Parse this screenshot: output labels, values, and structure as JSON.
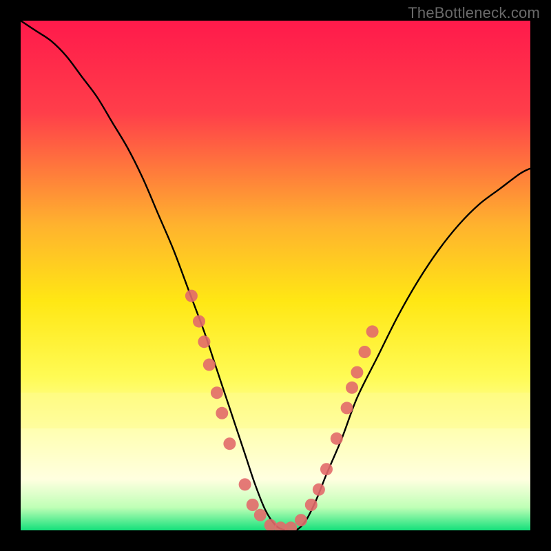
{
  "watermark": "TheBottleneck.com",
  "chart_data": {
    "type": "line",
    "title": "",
    "xlabel": "",
    "ylabel": "",
    "xlim": [
      0,
      100
    ],
    "ylim": [
      0,
      100
    ],
    "background_gradient": {
      "stops": [
        {
          "offset": 0.0,
          "color": "#ff1a4b"
        },
        {
          "offset": 0.18,
          "color": "#ff3e4a"
        },
        {
          "offset": 0.4,
          "color": "#ffb22e"
        },
        {
          "offset": 0.55,
          "color": "#ffe714"
        },
        {
          "offset": 0.7,
          "color": "#fffb55"
        },
        {
          "offset": 0.8,
          "color": "#ffffb0"
        },
        {
          "offset": 0.9,
          "color": "#ffffe0"
        },
        {
          "offset": 0.955,
          "color": "#bfffb6"
        },
        {
          "offset": 1.0,
          "color": "#14e07b"
        }
      ]
    },
    "series": [
      {
        "name": "bottleneck-curve",
        "color": "#000000",
        "x": [
          0,
          3,
          6,
          9,
          12,
          15,
          18,
          21,
          24,
          27,
          30,
          33,
          36,
          38,
          40,
          42,
          44,
          46,
          48,
          50,
          52,
          54,
          56,
          58,
          60,
          63,
          66,
          70,
          74,
          78,
          82,
          86,
          90,
          94,
          98,
          100
        ],
        "y": [
          100,
          98,
          96,
          93,
          89,
          85,
          80,
          75,
          69,
          62,
          55,
          47,
          39,
          33,
          27,
          21,
          15,
          9,
          4,
          1,
          0,
          0,
          2,
          6,
          11,
          18,
          26,
          34,
          42,
          49,
          55,
          60,
          64,
          67,
          70,
          71
        ]
      }
    ],
    "scatter": {
      "name": "marker-points",
      "color": "#e26a6a",
      "radius": 9,
      "points": [
        {
          "x": 33.5,
          "y": 46
        },
        {
          "x": 35,
          "y": 41
        },
        {
          "x": 36,
          "y": 37
        },
        {
          "x": 37,
          "y": 32.5
        },
        {
          "x": 38.5,
          "y": 27
        },
        {
          "x": 39.5,
          "y": 23
        },
        {
          "x": 41,
          "y": 17
        },
        {
          "x": 44,
          "y": 9
        },
        {
          "x": 45.5,
          "y": 5
        },
        {
          "x": 47,
          "y": 3
        },
        {
          "x": 49,
          "y": 1
        },
        {
          "x": 51,
          "y": 0.5
        },
        {
          "x": 53,
          "y": 0.5
        },
        {
          "x": 55,
          "y": 2
        },
        {
          "x": 57,
          "y": 5
        },
        {
          "x": 58.5,
          "y": 8
        },
        {
          "x": 60,
          "y": 12
        },
        {
          "x": 62,
          "y": 18
        },
        {
          "x": 64,
          "y": 24
        },
        {
          "x": 65,
          "y": 28
        },
        {
          "x": 66,
          "y": 31
        },
        {
          "x": 67.5,
          "y": 35
        },
        {
          "x": 69,
          "y": 39
        }
      ]
    },
    "pale_band": {
      "y_from": 73,
      "y_to": 80,
      "color": "#fffc8f",
      "opacity": 0.55
    }
  }
}
